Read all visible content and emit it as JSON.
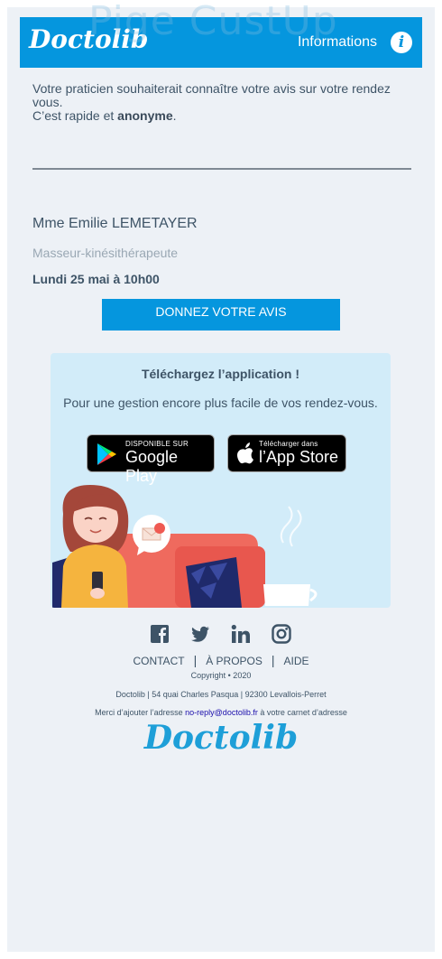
{
  "watermark": "Pige CustUp",
  "header": {
    "logo": "Doctolib",
    "info_label": "Informations",
    "info_icon": "info-icon"
  },
  "intro": {
    "line1": "Votre praticien souhaiterait connaître votre avis sur votre rendez vous.",
    "line2_prefix": "C’est rapide et ",
    "line2_bold": "anonyme",
    "line2_suffix": "."
  },
  "practitioner": {
    "name": "Mme Emilie LEMETAYER",
    "specialty": "Masseur-kinésithérapeute",
    "appointment": "Lundi 25 mai à 10h00"
  },
  "cta": {
    "label": "DONNEZ VOTRE AVIS"
  },
  "app_promo": {
    "title": "Téléchargez l’application !",
    "subtitle": "Pour une gestion encore plus facile de vos rendez-vous.",
    "google_play": {
      "small": "DISPONIBLE SUR",
      "big": "Google Play"
    },
    "app_store": {
      "small": "Télécharger dans",
      "big": "l’App Store"
    },
    "notification_count": "1"
  },
  "social": [
    "facebook-icon",
    "twitter-icon",
    "linkedin-icon",
    "instagram-icon"
  ],
  "footer": {
    "links": [
      "CONTACT",
      "À PROPOS",
      "AIDE"
    ],
    "copyright": "Copyright • 2020",
    "address": "Doctolib | 54 quai Charles Pasqua | 92300 Levallois-Perret",
    "addbook_prefix": "Merci d’ajouter l’adresse ",
    "addbook_email": "no-reply@doctolib.fr",
    "addbook_suffix": " à votre carnet d’adresse",
    "logo": "Doctolib"
  },
  "colors": {
    "brand_blue": "#0596de",
    "background": "#edf1f6",
    "app_box": "#d2ecf9",
    "text": "#3e5467"
  }
}
